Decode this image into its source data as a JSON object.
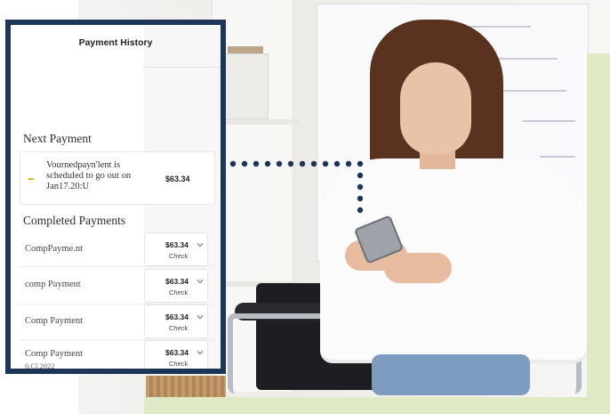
{
  "panel": {
    "title": "Payment History",
    "next_payment": {
      "heading": "Next Payment",
      "message": "Vournedpayn'lent is scheduled to go out on Jan17.20:U",
      "amount": "$63.34"
    },
    "completed": {
      "heading": "Completed Payments",
      "rows": [
        {
          "label": "CompPayme.nt",
          "sub": "",
          "amount": "$63.34",
          "action": "Check"
        },
        {
          "label": "comp Payment",
          "sub": "",
          "amount": "$63.34",
          "action": "Check"
        },
        {
          "label": "Comp Payment",
          "sub": "",
          "amount": "$63.34",
          "action": "Check"
        },
        {
          "label": "Comp Payment",
          "sub": "0.Cl.2022",
          "amount": "$63.34",
          "action": "Check"
        }
      ]
    }
  },
  "colors": {
    "panel_border": "#1d3557",
    "bullet": "#e3b21a",
    "connector": "#1d3557",
    "accent_green": "#dfe9c6"
  },
  "icons": {
    "row_expand": "chevron-down-icon",
    "bullet": "status-dot-icon"
  }
}
